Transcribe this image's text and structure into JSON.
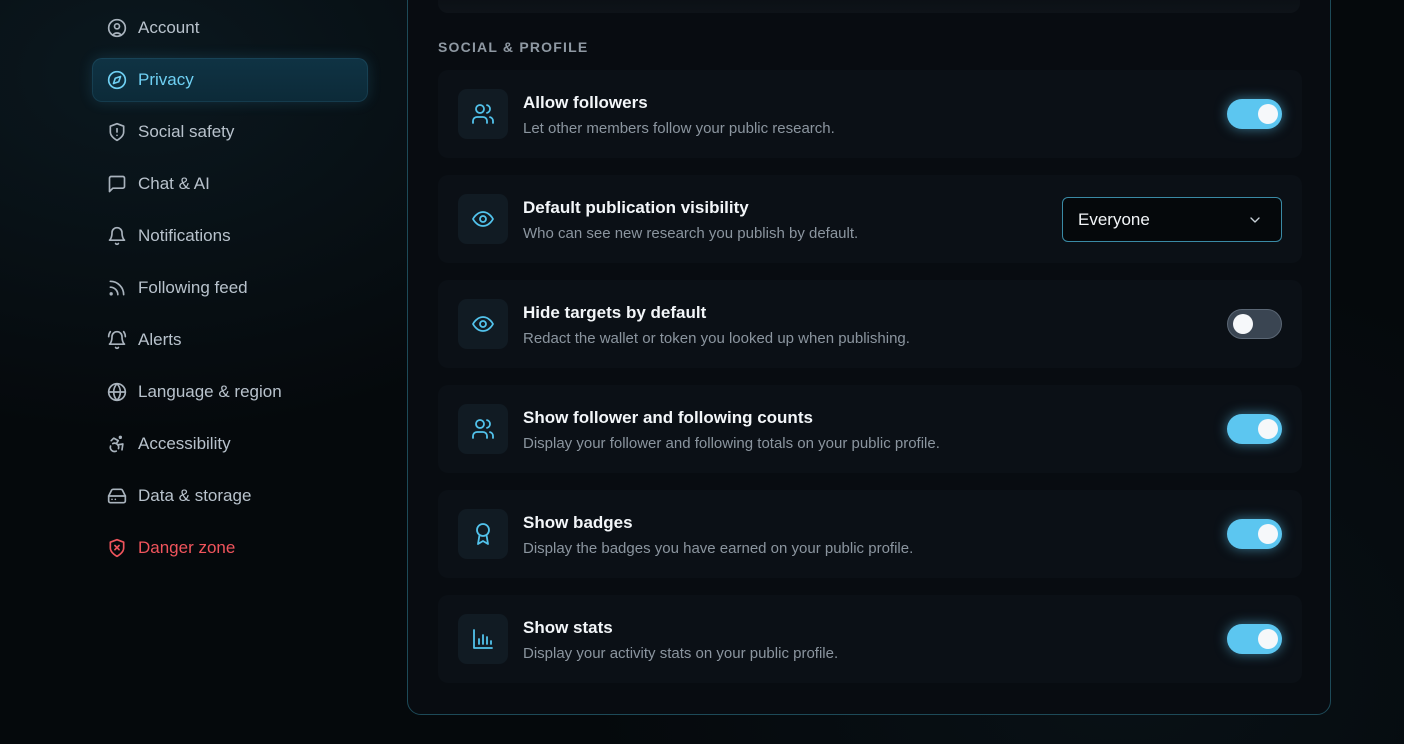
{
  "sidebar": {
    "items": [
      {
        "label": "Account",
        "icon": "user-circle-icon"
      },
      {
        "label": "Privacy",
        "icon": "compass-icon",
        "active": true
      },
      {
        "label": "Social safety",
        "icon": "shield-alert-icon"
      },
      {
        "label": "Chat & AI",
        "icon": "chat-bubble-icon"
      },
      {
        "label": "Notifications",
        "icon": "bell-icon"
      },
      {
        "label": "Following feed",
        "icon": "rss-icon"
      },
      {
        "label": "Alerts",
        "icon": "bell-ring-icon"
      },
      {
        "label": "Language & region",
        "icon": "globe-icon"
      },
      {
        "label": "Accessibility",
        "icon": "accessibility-icon"
      },
      {
        "label": "Data & storage",
        "icon": "hard-drive-icon"
      },
      {
        "label": "Danger zone",
        "icon": "shield-x-icon",
        "danger": true
      }
    ]
  },
  "section": {
    "title": "SOCIAL & PROFILE"
  },
  "settings": [
    {
      "title": "Allow followers",
      "description": "Let other members follow your public research.",
      "icon": "users-icon",
      "control": "toggle",
      "enabled": true
    },
    {
      "title": "Default publication visibility",
      "description": "Who can see new research you publish by default.",
      "icon": "eye-icon",
      "control": "select",
      "value": "Everyone"
    },
    {
      "title": "Hide targets by default",
      "description": "Redact the wallet or token you looked up when publishing.",
      "icon": "eye-icon",
      "control": "toggle",
      "enabled": false
    },
    {
      "title": "Show follower and following counts",
      "description": "Display your follower and following totals on your public profile.",
      "icon": "users-icon",
      "control": "toggle",
      "enabled": true
    },
    {
      "title": "Show badges",
      "description": "Display the badges you have earned on your public profile.",
      "icon": "award-icon",
      "control": "toggle",
      "enabled": true
    },
    {
      "title": "Show stats",
      "description": "Display your activity stats on your public profile.",
      "icon": "bar-chart-icon",
      "control": "toggle",
      "enabled": true
    }
  ],
  "colors": {
    "accent": "#5cc6f0",
    "danger": "#f0545c",
    "background": "#05090c"
  }
}
